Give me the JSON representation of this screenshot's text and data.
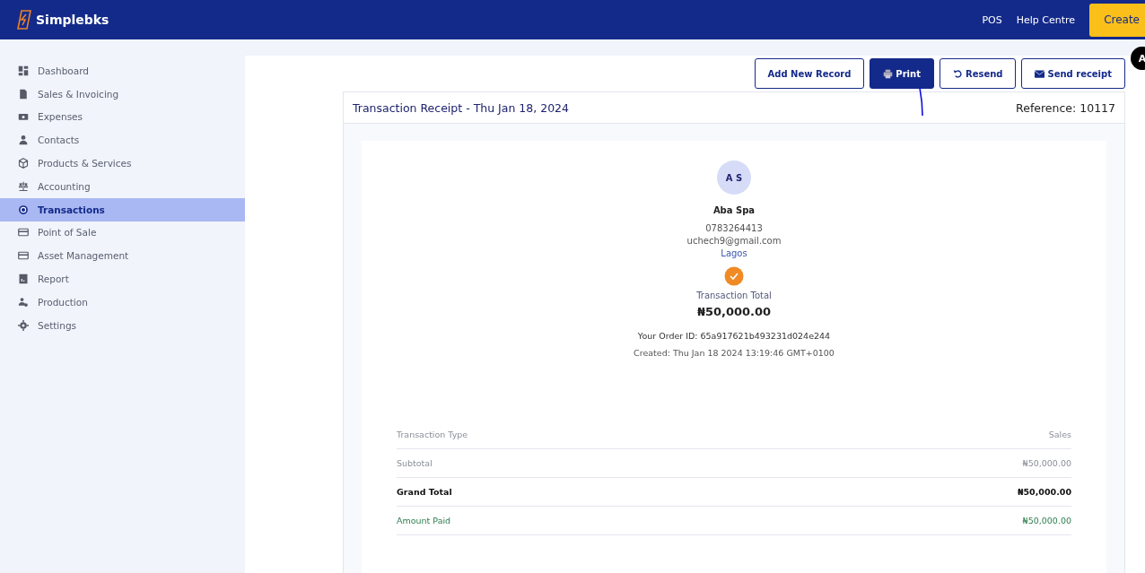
{
  "header": {
    "brand": "Simplebks",
    "links": [
      "POS",
      "Help Centre"
    ],
    "create_button": "Create",
    "avatar": "A"
  },
  "sidebar": {
    "items": [
      {
        "label": "Dashboard",
        "selected": false
      },
      {
        "label": "Sales & Invoicing",
        "selected": false
      },
      {
        "label": "Expenses",
        "selected": false
      },
      {
        "label": "Contacts",
        "selected": false
      },
      {
        "label": "Products & Services",
        "selected": false
      },
      {
        "label": "Accounting",
        "selected": false
      },
      {
        "label": "Transactions",
        "selected": true
      },
      {
        "label": "Point of Sale",
        "selected": false
      },
      {
        "label": "Asset Management",
        "selected": false
      },
      {
        "label": "Report",
        "selected": false
      },
      {
        "label": "Production",
        "selected": false
      },
      {
        "label": "Settings",
        "selected": false
      }
    ]
  },
  "actions": [
    {
      "label": "Add New Record",
      "kind": "outline"
    },
    {
      "label": "Print",
      "kind": "primary"
    },
    {
      "label": "Resend",
      "kind": "outline"
    },
    {
      "label": "Send receipt",
      "kind": "outline"
    }
  ],
  "receipt": {
    "title": "Transaction Receipt - Thu Jan 18, 2024",
    "reference": "Reference: 10117",
    "initials": "A S",
    "name": "Aba Spa",
    "phone": "0783264413",
    "email": "uchech9@gmail.com",
    "city": "Lagos",
    "total_label": "Transaction Total",
    "total": "₦50,000.00",
    "order_id": "Your Order ID: 65a917621b493231d024e244",
    "created": "Created: Thu Jan 18 2024 13:19:46 GMT+0100",
    "rows": [
      {
        "label": "Transaction Type",
        "value": "Sales",
        "kind": "muted"
      },
      {
        "label": "Subtotal",
        "value": "₦50,000.00",
        "kind": "muted"
      },
      {
        "label": "Grand Total",
        "value": "₦50,000.00",
        "kind": "bold"
      },
      {
        "label": "Amount Paid",
        "value": "₦50,000.00",
        "kind": "paid"
      }
    ]
  }
}
